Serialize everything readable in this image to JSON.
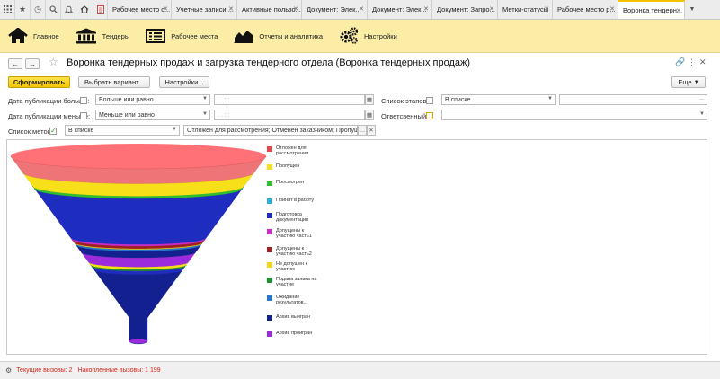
{
  "tabs": [
    {
      "label": "Рабочее место с...",
      "active": false
    },
    {
      "label": "Учетные записи ...",
      "active": false
    },
    {
      "label": "Активные пользо...",
      "active": false
    },
    {
      "label": "Документ: Элек...",
      "active": false
    },
    {
      "label": "Документ: Элек...",
      "active": false
    },
    {
      "label": "Документ: Запро...",
      "active": false
    },
    {
      "label": "Метки-статусы",
      "active": false
    },
    {
      "label": "Рабочее место р...",
      "active": false
    },
    {
      "label": "Воронка тендерн...",
      "active": true
    }
  ],
  "sections": [
    {
      "label": "Главное",
      "icon": "home-icon"
    },
    {
      "label": "Тендеры",
      "icon": "bank-icon"
    },
    {
      "label": "Рабочее места",
      "icon": "list-icon"
    },
    {
      "label": "Отчеты и аналитика",
      "icon": "chart-icon"
    },
    {
      "label": "Настройки",
      "icon": "gears-icon"
    }
  ],
  "form": {
    "title": "Воронка тендерных продаж и загрузка тендерного отдела (Воронка тендерных продаж)",
    "back": "←",
    "forward": "→"
  },
  "commands": {
    "generate": "Сформировать",
    "choose_variant": "Выбрать вариант...",
    "settings": "Настройки...",
    "more": "Еще"
  },
  "filters": {
    "pub_date_greater": {
      "label": "Дата публикации больше:",
      "checked": false,
      "condition": "Больше или равно",
      "value": "  .  .       :  :  "
    },
    "pub_date_less": {
      "label": "Дата публикации меньше:",
      "checked": false,
      "condition": "Меньше или равно",
      "value": "  .  .       :  :  "
    },
    "stage_list": {
      "label": "Список этапов:",
      "checked": false,
      "condition": "В списке",
      "value": ""
    },
    "responsible": {
      "label": "Ответсвенный:",
      "checked": false,
      "value": ""
    },
    "tag_list": {
      "label": "Список меток:",
      "checked": true,
      "condition": "В списке",
      "value": "Отложен для рассмотрения; Отменен заказчиком; Пропущен; П..."
    }
  },
  "chart_data": {
    "type": "funnel",
    "series": [
      {
        "name": "Отложен для рассмотрения",
        "color": "#e8454b"
      },
      {
        "name": "Пропущен",
        "color": "#f7e01a"
      },
      {
        "name": "Просмотрен",
        "color": "#2dbf2d"
      },
      {
        "name": "Принят в работу",
        "color": "#2bb0d8"
      },
      {
        "name": "Подготовка документации",
        "color": "#1e2cc0"
      },
      {
        "name": "Допущены к участию часть1",
        "color": "#cc2bcc"
      },
      {
        "name": "Допущены к участию часть2",
        "color": "#a01f1f"
      },
      {
        "name": "Не допущен к участию",
        "color": "#f5d61a"
      },
      {
        "name": "Подана заявка на участие",
        "color": "#1f8f2f"
      },
      {
        "name": "Ожидание результатов...",
        "color": "#2676d0"
      },
      {
        "name": "Архив выигран",
        "color": "#13208f"
      },
      {
        "name": "Архив проигран",
        "color": "#9b2bdc"
      }
    ]
  },
  "status": {
    "current_calls": "Текущие вызовы: 2",
    "accumulated_calls": "Накопленные вызовы: 1 199"
  }
}
